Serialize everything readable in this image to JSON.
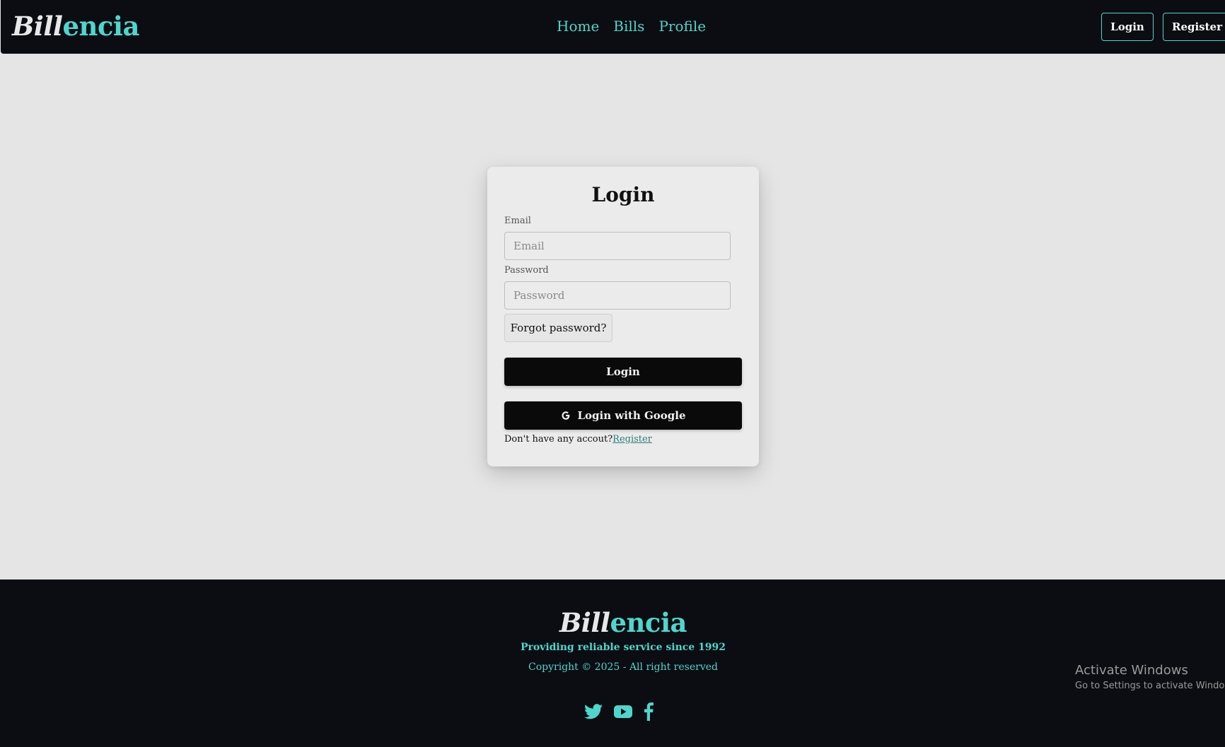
{
  "brand": {
    "part1": "Bill",
    "part2": "encia"
  },
  "nav": {
    "links": [
      "Home",
      "Bills",
      "Profile"
    ],
    "login_label": "Login",
    "register_label": "Register"
  },
  "login_card": {
    "title": "Login",
    "email_label": "Email",
    "email_placeholder": "Email",
    "password_label": "Password",
    "password_placeholder": "Password",
    "forgot_label": "Forgot password?",
    "login_button": "Login",
    "google_button": "Login with Google",
    "no_account_text": "Don't have any accout?",
    "register_link": "Register"
  },
  "footer": {
    "tagline": "Providing reliable service since 1992",
    "copyright": "Copyright © 2025 - All right reserved",
    "social_icons": [
      "twitter-icon",
      "youtube-icon",
      "facebook-icon"
    ]
  },
  "system_overlay": {
    "title": "Activate Windows",
    "subtitle": "Go to Settings to activate Windows."
  },
  "colors": {
    "accent": "#4fd6cc",
    "navbar_bg": "#0b0d12",
    "page_bg": "#e5e5e5",
    "button_dark": "#0a0a0a"
  }
}
